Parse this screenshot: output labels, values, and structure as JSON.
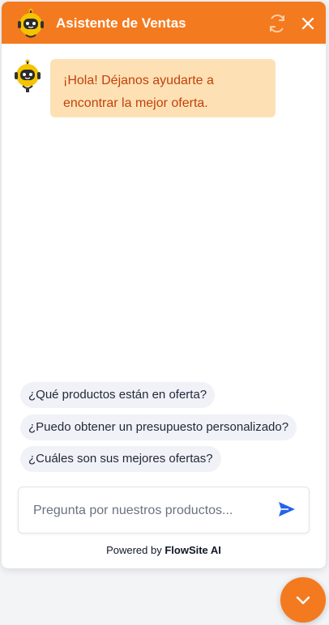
{
  "colors": {
    "accent": "#f47a1f",
    "bubble_bg": "#fde1b4",
    "bubble_text": "#c2410c",
    "send_icon": "#2563eb"
  },
  "header": {
    "title": "Asistente de Ventas",
    "avatar_icon": "robot-icon",
    "refresh_icon": "refresh-icon",
    "close_icon": "close-icon"
  },
  "conversation": {
    "messages": [
      {
        "sender": "bot",
        "text": "¡Hola! Déjanos ayudarte a encontrar la mejor oferta."
      }
    ]
  },
  "suggestions": [
    "¿Qué productos están en oferta?",
    "¿Puedo obtener un presupuesto personalizado?",
    "¿Cuáles son sus mejores ofertas?"
  ],
  "composer": {
    "placeholder": "Pregunta por nuestros productos...",
    "value": "",
    "send_icon": "send-icon"
  },
  "footer": {
    "powered_prefix": "Powered by",
    "brand": "FlowSite AI"
  },
  "launcher": {
    "icon": "chevron-down-icon"
  }
}
